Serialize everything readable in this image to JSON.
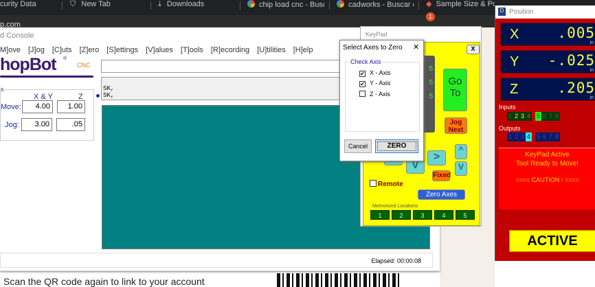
{
  "browser": {
    "tabs": [
      "curity Data",
      "New Tab",
      "Downloads",
      "chip load cnc - Buscar",
      "cadworks - Buscar co",
      "Sample Size & Powe"
    ],
    "address": "p.com",
    "notification_count": "1"
  },
  "console": {
    "title": "d Console",
    "menu": [
      "M]ove",
      "[J]og",
      "[C]uts",
      "[Z]ero",
      "[S]ettings",
      "[V]alues",
      "[T]ools",
      "[R]ecording",
      "[U]tilities",
      "[H]elp"
    ],
    "logo_text": "hopBot",
    "logo_reg": "®",
    "logo_cnc": "CNC",
    "command_value": "",
    "messages": [
      "SK,",
      "SK,"
    ],
    "speeds": {
      "group_label": "s",
      "col_xy": "X & Y",
      "col_z": "Z",
      "move_label": "Move:",
      "jog_label": "Jog:",
      "move_xy": "4.00",
      "move_z": "1.00",
      "jog_xy": "3.00",
      "jog_z": ".05"
    },
    "elapsed": "Elapsed: 00:00:08"
  },
  "page": {
    "qr_text": "Scan the QR code again to link to your account"
  },
  "keypad": {
    "title": "KeyPad",
    "close": "X",
    "goto_line1": "Go",
    "goto_line2": "To",
    "jog_next_1": "Jog",
    "jog_next_2": "Next",
    "right": ">",
    "up": "^",
    "down": "V",
    "down2": "V",
    "fixed": "Fixed",
    "remote": "Remote",
    "zero_axes": "Zero Axes",
    "memorized_label": "Memorized Locations",
    "locations": [
      "1",
      "2",
      "3",
      "4",
      "5"
    ],
    "display_digits": [
      "5",
      "5",
      "5"
    ]
  },
  "dialog": {
    "title": "Select Axes to Zero",
    "close": "✕",
    "group": "Check Axis",
    "axes": [
      {
        "label": "X - Axis",
        "checked": true
      },
      {
        "label": "Y - Axis",
        "checked": true
      },
      {
        "label": "Z - Axis",
        "checked": false
      }
    ],
    "cancel": "Cancel",
    "zero": "ZERO"
  },
  "position": {
    "title": "Position",
    "x_label": "X",
    "x": ".005",
    "y_label": "Y",
    "y": "-.025",
    "z_label": "Z",
    "z": ".205",
    "unit": "in",
    "inputs_label": "Inputs",
    "inputs": [
      "1",
      "2",
      "3",
      "4",
      "5",
      "6",
      "7",
      "8"
    ],
    "outputs_label": "Outputs",
    "outputs": [
      "1",
      "2",
      "3",
      "4",
      "5",
      "6",
      "7",
      "8"
    ],
    "message1": "KeyPad Active",
    "message2": "Tool Ready to Move!",
    "message3": "==== CAUTION ! ====",
    "active": "ACTIVE"
  }
}
